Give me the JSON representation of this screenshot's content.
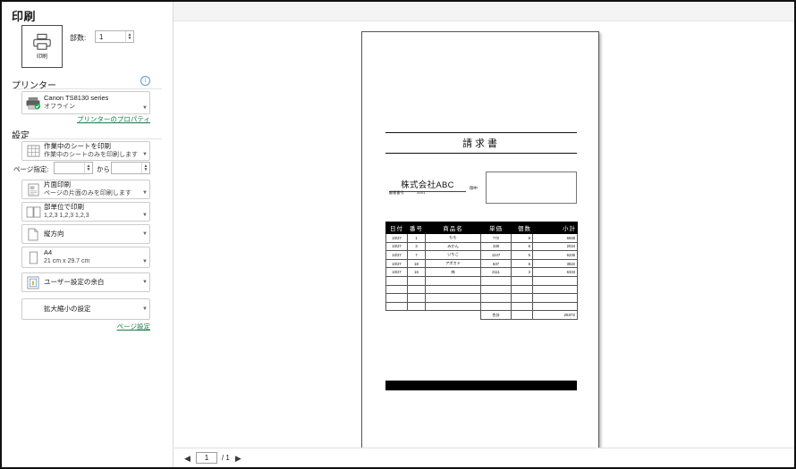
{
  "window": {
    "title": "印刷"
  },
  "print": {
    "button_label": "印刷",
    "button_icon": "printer-icon",
    "copies_label": "部数:",
    "copies_value": "1"
  },
  "printer": {
    "section_title": "プリンター",
    "info_icon": "info-icon",
    "name": "Canon TS8130 series",
    "status": "オフライン",
    "icon": "printer-device-icon",
    "properties_link": "プリンターのプロパティ",
    "link_color": "#1a7a4a"
  },
  "settings": {
    "section_title": "設定",
    "items": [
      {
        "icon": "sheet-grid-icon",
        "line1": "作業中のシートを印刷",
        "line2": "作業中のシートのみを印刷します"
      },
      {
        "icon": "one-sided-icon",
        "line1": "片面印刷",
        "line2": "ページの片面のみを印刷します"
      },
      {
        "icon": "collate-icon",
        "line1": "部単位で印刷",
        "line2": "1,2,3   1,2,3   1,2,3"
      },
      {
        "icon": "portrait-icon",
        "line1": "縦方向",
        "line2": ""
      },
      {
        "icon": "paper-size-icon",
        "line1": "A4",
        "line2": "21 cm x 29.7 cm"
      },
      {
        "icon": "margins-icon",
        "line1": "ユーザー設定の余白",
        "line2": ""
      },
      {
        "icon": "",
        "line1": "拡大縮小の設定",
        "line2": ""
      }
    ],
    "page_range": {
      "label": "ページ指定:",
      "from_value": "",
      "separator": "から",
      "to_value": ""
    },
    "page_setup_link": "ページ設定"
  },
  "document": {
    "title": "請求書",
    "customer_name": "株式会社ABC",
    "honorific": "御中",
    "customer_no_label": "顧客番号",
    "customer_no_value": "1001",
    "table": {
      "headers": [
        "日付",
        "番号",
        "商品名",
        "単価",
        "個数",
        "小計"
      ],
      "rows": [
        [
          "10/27",
          "1",
          "もも",
          "772",
          "8",
          "6948"
        ],
        [
          "10/27",
          "3",
          "みかん",
          "339",
          "6",
          "2034"
        ],
        [
          "10/27",
          "7",
          "いちご",
          "1247",
          "5",
          "6235"
        ],
        [
          "10/27",
          "18",
          "アボカド",
          "637",
          "6",
          "3822"
        ],
        [
          "10/27",
          "16",
          "柿",
          "2111",
          "3",
          "6333"
        ]
      ],
      "blank_rows": 4,
      "total_label": "合計",
      "total_value": "25372"
    }
  },
  "pagination": {
    "prev_icon": "prev-page-arrow-icon",
    "next_icon": "next-page-arrow-icon",
    "current_page": "1",
    "total_pages": "/ 1"
  }
}
